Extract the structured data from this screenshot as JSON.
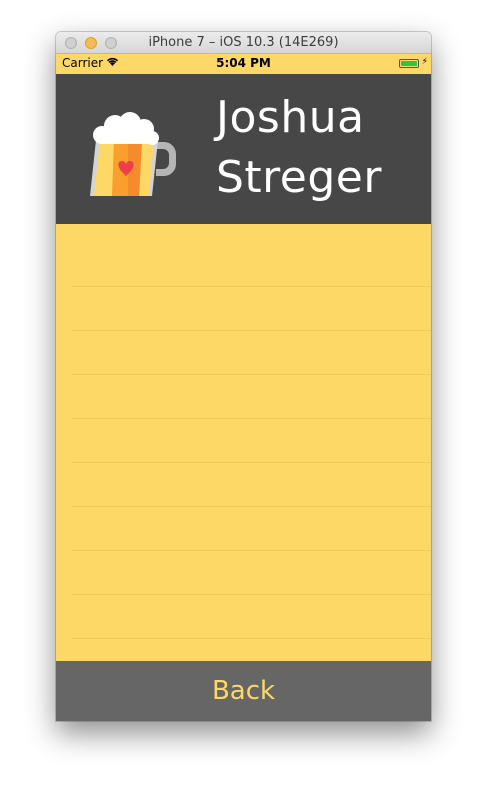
{
  "window": {
    "title": "iPhone 7 – iOS 10.3 (14E269)"
  },
  "status_bar": {
    "carrier": "Carrier",
    "time": "5:04 PM"
  },
  "header": {
    "first_name": "Joshua",
    "last_name": "Streger",
    "logo_icon": "beer-mug-heart-icon"
  },
  "list": {
    "rows": [
      "",
      "",
      "",
      "",
      "",
      "",
      "",
      "",
      ""
    ]
  },
  "footer": {
    "back_label": "Back"
  },
  "colors": {
    "accent_yellow": "#fdd867",
    "header_bg": "#474747",
    "footer_bg": "#666666"
  }
}
